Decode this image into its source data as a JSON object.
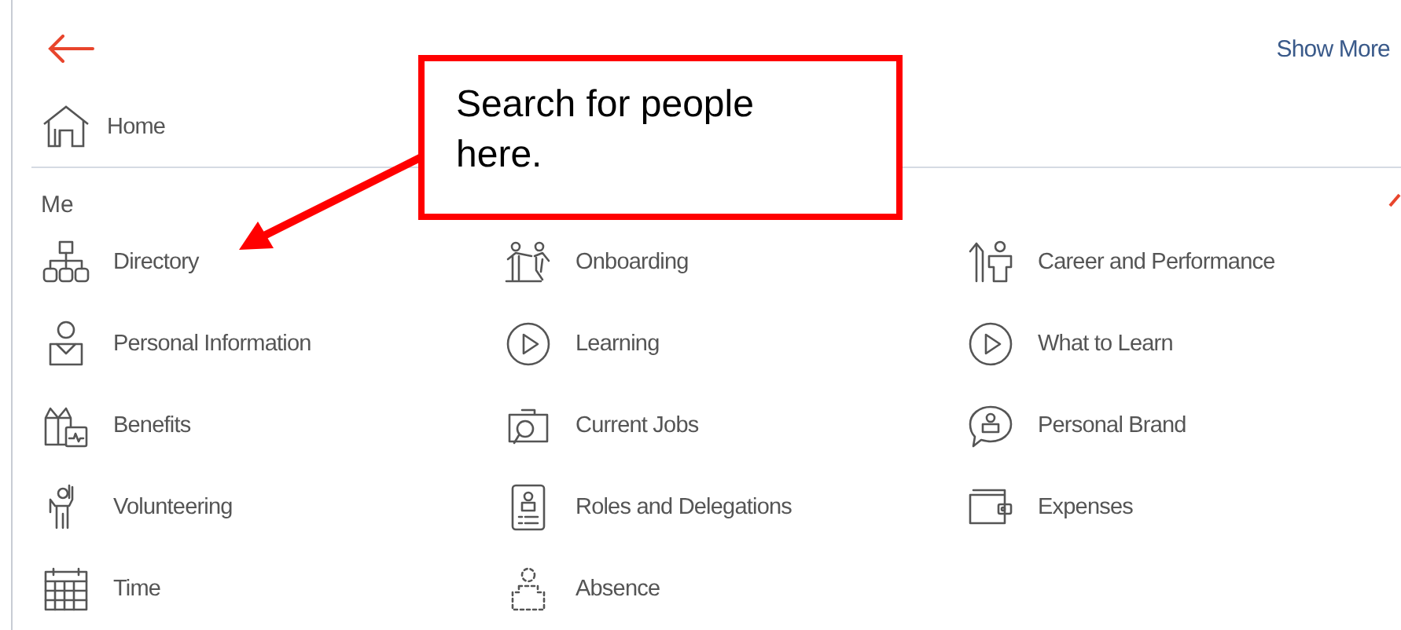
{
  "header": {
    "show_more": "Show More"
  },
  "home": {
    "label": "Home"
  },
  "section": {
    "title": "Me",
    "items": [
      {
        "label": "Directory"
      },
      {
        "label": "Onboarding"
      },
      {
        "label": "Career and Performance"
      },
      {
        "label": "Personal Information"
      },
      {
        "label": "Learning"
      },
      {
        "label": "What to Learn"
      },
      {
        "label": "Benefits"
      },
      {
        "label": "Current Jobs"
      },
      {
        "label": "Personal Brand"
      },
      {
        "label": "Volunteering"
      },
      {
        "label": "Roles and Delegations"
      },
      {
        "label": "Expenses"
      },
      {
        "label": "Time"
      },
      {
        "label": "Absence"
      }
    ]
  },
  "callout": {
    "text": "Search for people here."
  }
}
